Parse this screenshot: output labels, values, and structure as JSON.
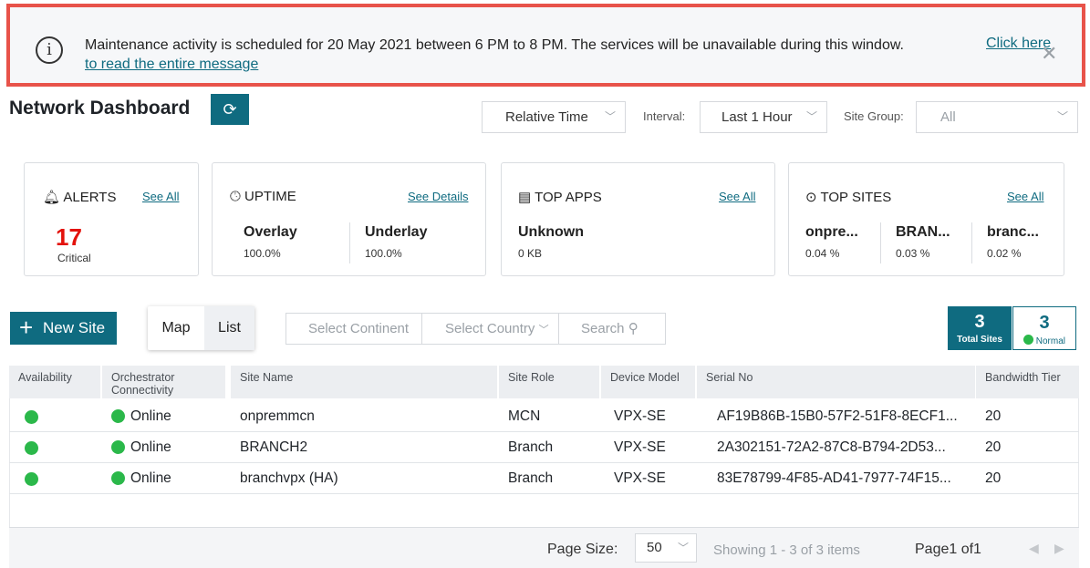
{
  "banner": {
    "message": "Maintenance activity is scheduled for 20 May 2021 between 6 PM to 8 PM. The services will be unavailable during this window.",
    "link_part1": "Click here",
    "link_part2": "to read the entire message",
    "close": "✕",
    "info": "i"
  },
  "header": {
    "title": "Network Dashboard",
    "refresh": "⟳",
    "time_select": "Relative Time",
    "interval_label": "Interval:",
    "interval_value": "Last 1 Hour",
    "site_group_label": "Site Group:",
    "site_group_value": "All"
  },
  "cards": {
    "alerts": {
      "title": "ALERTS",
      "link": "See All",
      "count": "17",
      "sub": "Critical"
    },
    "uptime": {
      "title": "UPTIME",
      "link": "See Details",
      "items": [
        {
          "name": "Overlay",
          "value": "100.0%"
        },
        {
          "name": "Underlay",
          "value": "100.0%"
        }
      ]
    },
    "top_apps": {
      "title": "TOP APPS",
      "link": "See All",
      "items": [
        {
          "name": "Unknown",
          "value": "0 KB"
        }
      ]
    },
    "top_sites": {
      "title": "TOP SITES",
      "link": "See All",
      "items": [
        {
          "name": "onpre...",
          "value": "0.04 %"
        },
        {
          "name": "BRAN...",
          "value": "0.03 %"
        },
        {
          "name": "branc...",
          "value": "0.02 %"
        }
      ]
    }
  },
  "toolbar": {
    "new_site": "New Site",
    "view_map": "Map",
    "view_list": "List",
    "continent_placeholder": "Select Continent",
    "country_placeholder": "Select Country",
    "search_placeholder": "Search",
    "total_sites_count": "3",
    "total_sites_label": "Total Sites",
    "normal_count": "3",
    "normal_label": "Normal"
  },
  "table": {
    "columns": [
      "Availability",
      "Orchestrator Connectivity",
      "Site Name",
      "Site Role",
      "Device Model",
      "Serial No",
      "Bandwidth Tier"
    ],
    "rows": [
      {
        "connectivity": "Online",
        "site_name": "onpremmcn",
        "role": "MCN",
        "model": "VPX-SE",
        "serial": "AF19B86B-15B0-57F2-51F8-8ECF1...",
        "bandwidth": "20"
      },
      {
        "connectivity": "Online",
        "site_name": "BRANCH2",
        "role": "Branch",
        "model": "VPX-SE",
        "serial": "2A302151-72A2-87C8-B794-2D53...",
        "bandwidth": "20"
      },
      {
        "connectivity": "Online",
        "site_name": "branchvpx (HA)",
        "role": "Branch",
        "model": "VPX-SE",
        "serial": "83E78799-4F85-AD41-7977-74F15...",
        "bandwidth": "20"
      }
    ]
  },
  "footer": {
    "page_size_label": "Page Size:",
    "page_size_value": "50",
    "showing": "Showing 1 - 3 of 3 items",
    "page": "Page1 of1"
  },
  "colors": {
    "accent": "#0f6b80",
    "alert": "#e3120b",
    "online": "#2bb84a",
    "banner_border": "#e8534a"
  }
}
